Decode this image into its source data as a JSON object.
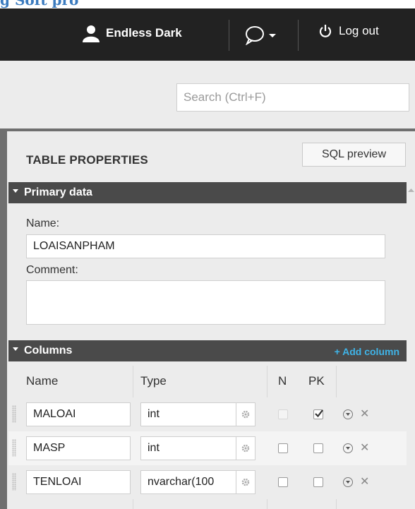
{
  "page_header": {
    "title_fragment": "g Soft pro"
  },
  "topbar": {
    "user_name": "Endless Dark",
    "logout_label": "Log out"
  },
  "search": {
    "placeholder": "Search (Ctrl+F)"
  },
  "panel": {
    "title": "TABLE PROPERTIES",
    "sql_preview_label": "SQL preview"
  },
  "primary": {
    "section_title": "Primary data",
    "name_label": "Name:",
    "name_value": "LOAISANPHAM",
    "comment_label": "Comment:",
    "comment_value": ""
  },
  "columns": {
    "section_title": "Columns",
    "add_label": "+ Add column",
    "headers": {
      "name": "Name",
      "type": "Type",
      "n": "N",
      "pk": "PK"
    },
    "rows": [
      {
        "name": "MALOAI",
        "type": "int",
        "nullable": false,
        "pk": true
      },
      {
        "name": "MASP",
        "type": "int",
        "nullable": false,
        "pk": false
      },
      {
        "name": "TENLOAI",
        "type": "nvarchar(100",
        "nullable": false,
        "pk": false
      }
    ]
  },
  "colors": {
    "topbar": "#222222",
    "section": "#4a4a4a",
    "accent": "#3fb4e8"
  }
}
